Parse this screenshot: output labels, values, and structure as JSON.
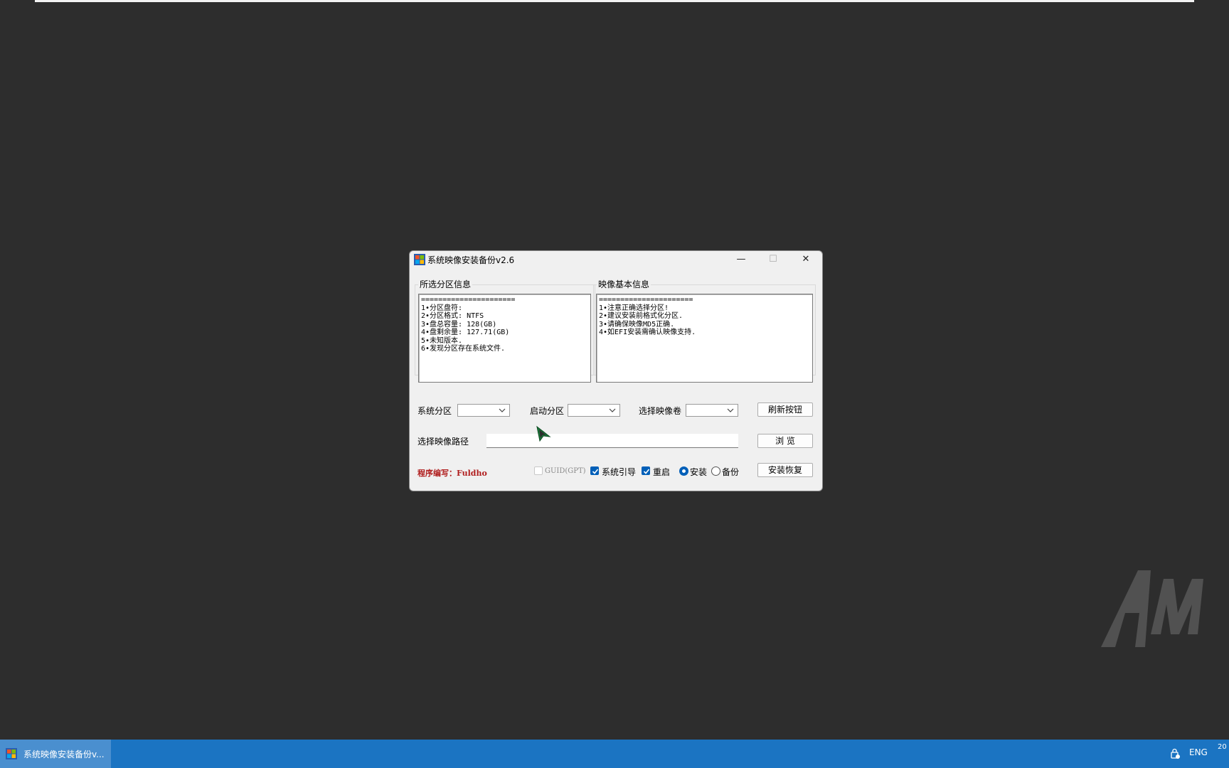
{
  "window": {
    "title": "系统映像安装备份v2.6",
    "minimize": "—",
    "maximize": "☐",
    "close": "✕"
  },
  "partition_info": {
    "title": "所选分区信息",
    "text": "======================\n1•分区盘符:\n2•分区格式: NTFS\n3•盘总容量: 128(GB)\n4•盘剩余量: 127.71(GB)\n5•未知版本.\n6•发现分区存在系统文件."
  },
  "image_info": {
    "title": "映像基本信息",
    "text": "======================\n1•注意正确选择分区!\n2•建议安装前格式化分区.\n3•请确保映像MD5正确.\n4•如EFI安装需确认映像支持."
  },
  "controls": {
    "system_partition_label": "系统分区",
    "boot_partition_label": "启动分区",
    "image_volume_label": "选择映像卷",
    "refresh_button": "刷新按钮",
    "image_path_label": "选择映像路径",
    "image_path_value": "",
    "browse_button": "浏  览",
    "credit": "程序编写：Fuldho",
    "guid_label": "GUID(GPT)",
    "guid_checked": false,
    "sysboot_label": "系统引导",
    "sysboot_checked": true,
    "restart_label": "重启",
    "restart_checked": true,
    "install_label": "安装",
    "backup_label": "备份",
    "mode_selected": "install",
    "install_restore_button": "安装恢复"
  },
  "taskbar": {
    "item_label": "系统映像安装备份v...",
    "lang": "ENG",
    "clock_partial": "20"
  },
  "colors": {
    "desktop": "#2d2d2d",
    "taskbar": "#1b74c2",
    "accent": "#005fb8",
    "credit": "#b01e1e"
  }
}
